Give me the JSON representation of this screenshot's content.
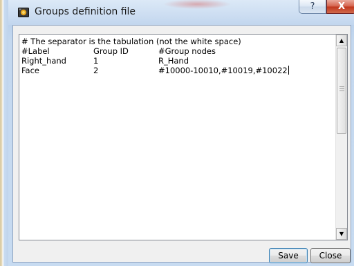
{
  "window": {
    "title": "Groups definition file",
    "help_glyph": "?",
    "close_glyph": "X"
  },
  "editor": {
    "lines": [
      {
        "cells": [
          "# The separator is the tabulation (not the white space)"
        ]
      },
      {
        "cells": [
          "#Label",
          "Group ID",
          "#Group nodes"
        ]
      },
      {
        "cells": [
          "Right_hand",
          "1",
          "R_Hand"
        ]
      },
      {
        "cells": [
          "Face",
          "2",
          "#10000-10010,#10019,#10022"
        ]
      }
    ]
  },
  "scrollbar": {
    "up_glyph": "▲",
    "down_glyph": "▼"
  },
  "buttons": {
    "save_label": "Save",
    "close_label": "Close"
  },
  "icons": {
    "app": "app-window-icon",
    "help": "help-icon",
    "close": "close-icon"
  },
  "colors": {
    "title_bar": "#c2d6ee",
    "close_button": "#c0351b",
    "dialog_face": "#f0f0f0"
  }
}
